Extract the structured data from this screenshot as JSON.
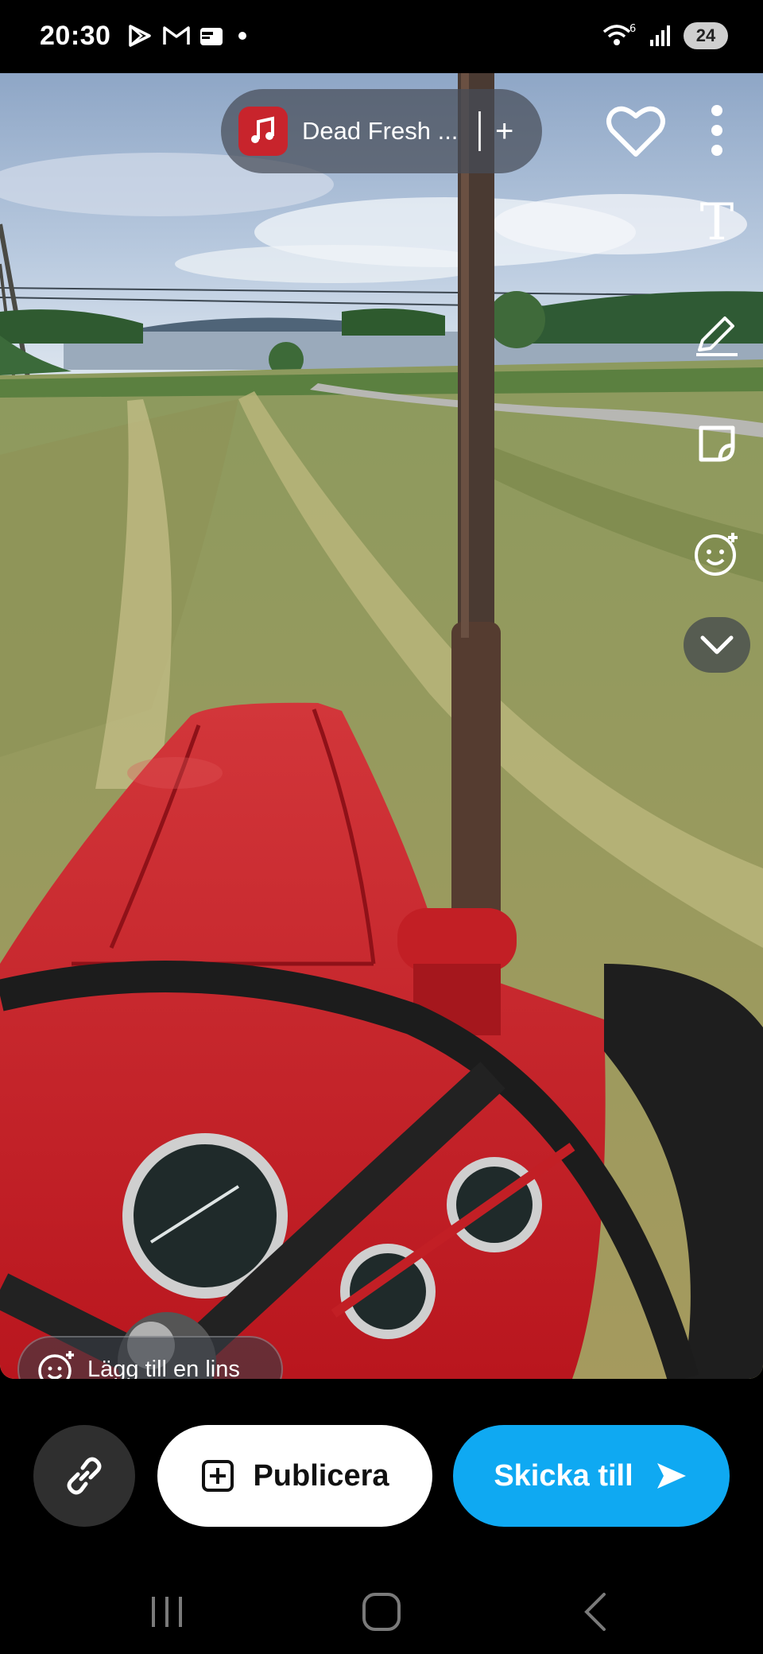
{
  "status_bar": {
    "time": "20:30",
    "left_icons": [
      "play-store-icon",
      "gmail-icon",
      "wallet-icon",
      "dot-icon"
    ],
    "right_icons": [
      "wifi-6-icon",
      "signal-icon"
    ],
    "wifi_label": "6",
    "battery": "24"
  },
  "sound": {
    "title": "Dead Fresh ...",
    "add_label": "+"
  },
  "tools": [
    "heart-icon",
    "more-icon",
    "text-icon",
    "draw-icon",
    "sticker-icon",
    "lens-effects-icon",
    "chevron-down-icon"
  ],
  "text_tool_glyph": "T",
  "lens": {
    "label": "Lägg till en lins"
  },
  "actions": {
    "publish_label": "Publicera",
    "send_label": "Skicka till"
  },
  "colors": {
    "send_button": "#0fa9f2",
    "publish_button": "#ffffff",
    "link_button": "#2f2f2f",
    "sound_icon": "#c8242c"
  },
  "nav": [
    "recent-apps-icon",
    "home-icon",
    "back-icon"
  ]
}
